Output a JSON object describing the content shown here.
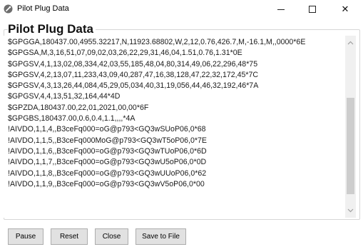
{
  "window": {
    "title": "Pilot Plug Data",
    "minimize_label": "—",
    "maximize_label": "",
    "close_label": "✕"
  },
  "panel": {
    "heading": "Pilot Plug Data"
  },
  "log": {
    "lines": [
      "$GPGGA,180437.00,4955.32217,N,11923.68802,W,2,12,0.76,426.7,M,-16.1,M,,0000*6E",
      "$GPGSA,M,3,16,51,07,09,02,03,26,22,29,31,46,04,1.51,0.76,1.31*0E",
      "$GPGSV,4,1,13,02,08,334,42,03,55,185,48,04,80,314,49,06,22,296,48*75",
      "$GPGSV,4,2,13,07,11,233,43,09,40,287,47,16,38,128,47,22,32,172,45*7C",
      "$GPGSV,4,3,13,26,44,084,45,29,05,034,40,31,19,056,44,46,32,192,46*7A",
      "$GPGSV,4,4,13,51,32,164,44*4D",
      "$GPZDA,180437.00,22,01,2021,00,00*6F",
      "$GPGBS,180437.00,0.6,0.4,1.1,,,,*4A",
      "!AIVDO,1,1,4,,B3ceFq000=oG@p793<GQ3wSUoP06,0*68",
      "!AIVDO,1,1,5,,B3ceFq000MoG@p793<GQ3wT5oP06,0*7E",
      "!AIVDO,1,1,6,,B3ceFq000=oG@p793<GQ3wTUoP06,0*6D",
      "!AIVDO,1,1,7,,B3ceFq000=oG@p793<GQ3wU5oP06,0*0D",
      "!AIVDO,1,1,8,,B3ceFq000=oG@p793<GQ3wUUoP06,0*62",
      "!AIVDO,1,1,9,,B3ceFq000=oG@p793<GQ3wV5oP06,0*00"
    ]
  },
  "scrollbar": {
    "up_icon": "chevron-up-icon",
    "down_icon": "chevron-down-icon"
  },
  "buttons": {
    "pause": "Pause",
    "reset": "Reset",
    "close": "Close",
    "save": "Save to File"
  },
  "colors": {
    "button_bg": "#e1e1e1",
    "button_border": "#adadad",
    "thumb": "#cdcdcd",
    "track": "#f0f0f0"
  }
}
